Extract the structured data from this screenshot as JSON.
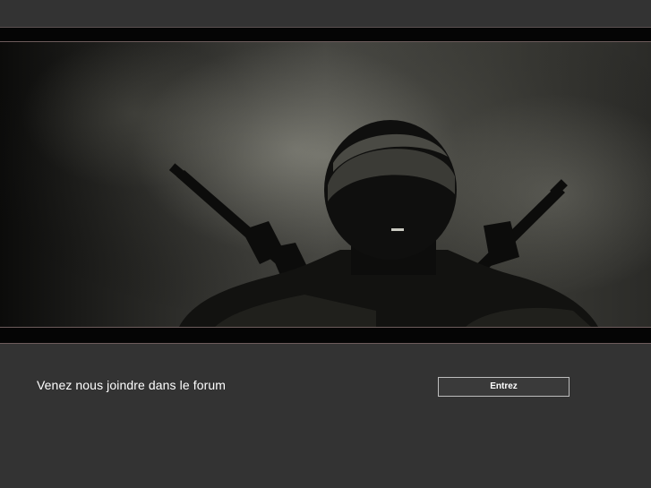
{
  "banner": {
    "image": "soldier-silhouette-with-rifles-in-smoke"
  },
  "main": {
    "invite_text": "Venez nous joindre dans le forum",
    "enter_label": "Entrez"
  },
  "colors": {
    "background": "#333333",
    "strip": "#050505",
    "strip_border": "#6d5c5c",
    "button_border": "#bdbdbd",
    "text": "#ffffff"
  }
}
